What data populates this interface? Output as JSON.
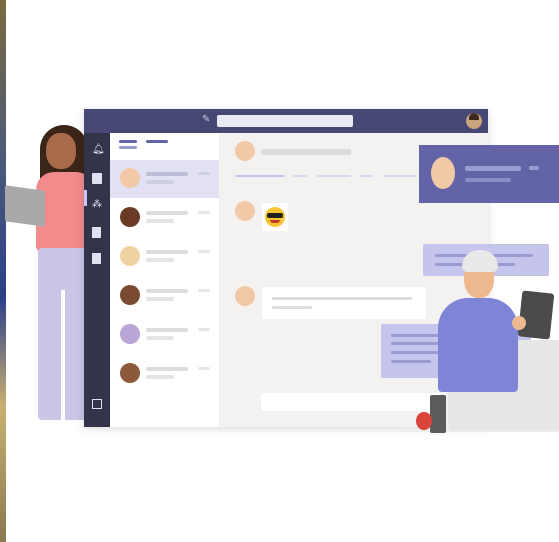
{
  "illustration": {
    "title": "",
    "colors": {
      "titlebar": "#464775",
      "rail": "#33344a",
      "accent": "#6264a7",
      "selected_row": "#e1e1f3",
      "chat_bg": "#f3f2f1",
      "my_bubble": "#c4c4ec"
    }
  },
  "titlebar": {
    "search_placeholder": "",
    "compose_icon": "compose-icon",
    "avatar_icon": "user-avatar"
  },
  "rail": {
    "items": [
      {
        "icon": "bell-icon"
      },
      {
        "icon": "chat-icon"
      },
      {
        "icon": "teams-icon"
      },
      {
        "icon": "calendar-icon"
      },
      {
        "icon": "files-icon"
      },
      {
        "icon": "apps-icon"
      }
    ]
  },
  "chat_list": {
    "rows": 6,
    "selected_index": 0
  },
  "messages": {
    "emoji": "sunglasses-emoji"
  },
  "notification": {
    "icon": "chevron-right-icon"
  }
}
